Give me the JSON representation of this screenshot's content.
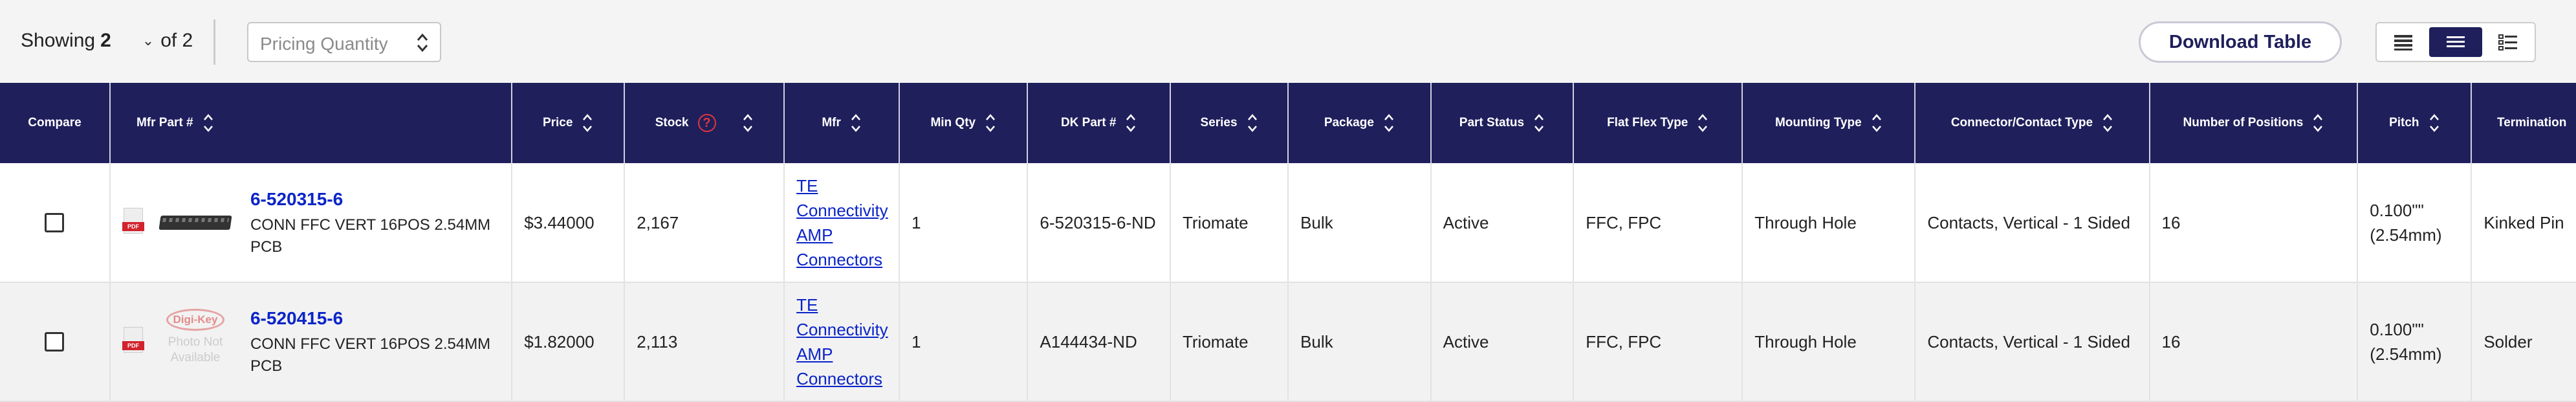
{
  "toolbar": {
    "showing_label": "Showing",
    "showing_value": "2",
    "of_label": "of 2",
    "pricing_placeholder": "Pricing Quantity",
    "download_label": "Download Table"
  },
  "columns": [
    {
      "label": "Compare",
      "sortable": false
    },
    {
      "label": "Mfr Part #",
      "sortable": true
    },
    {
      "label": "Price",
      "sortable": true
    },
    {
      "label": "Stock",
      "sortable": true,
      "help": true
    },
    {
      "label": "Mfr",
      "sortable": true
    },
    {
      "label": "Min Qty",
      "sortable": true
    },
    {
      "label": "DK Part #",
      "sortable": true
    },
    {
      "label": "Series",
      "sortable": true
    },
    {
      "label": "Package",
      "sortable": true
    },
    {
      "label": "Part Status",
      "sortable": true
    },
    {
      "label": "Flat Flex Type",
      "sortable": true
    },
    {
      "label": "Mounting Type",
      "sortable": true
    },
    {
      "label": "Connector/Contact Type",
      "sortable": true
    },
    {
      "label": "Number of Positions",
      "sortable": true
    },
    {
      "label": "Pitch",
      "sortable": true
    },
    {
      "label": "Termination",
      "sortable": true
    }
  ],
  "rows": [
    {
      "part_number": "6-520315-6",
      "description": "CONN FFC VERT 16POS 2.54MM PCB",
      "photo": "connector",
      "price": "$3.44000",
      "stock": "2,167",
      "mfr": "TE Connectivity AMP Connectors",
      "min_qty": "1",
      "dk_part": "6-520315-6-ND",
      "series": "Triomate",
      "package": "Bulk",
      "part_status": "Active",
      "flat_flex_type": "FFC, FPC",
      "mounting_type": "Through Hole",
      "connector_type": "Contacts, Vertical - 1 Sided",
      "positions": "16",
      "pitch": "0.100\"\" (2.54mm)",
      "termination": "Kinked Pin"
    },
    {
      "part_number": "6-520415-6",
      "description": "CONN FFC VERT 16POS 2.54MM PCB",
      "photo": "none",
      "photo_logo": "Digi-Key",
      "photo_text": "Photo Not Available",
      "price": "$1.82000",
      "stock": "2,113",
      "mfr": "TE Connectivity AMP Connectors",
      "min_qty": "1",
      "dk_part": "A144434-ND",
      "series": "Triomate",
      "package": "Bulk",
      "part_status": "Active",
      "flat_flex_type": "FFC, FPC",
      "mounting_type": "Through Hole",
      "connector_type": "Contacts, Vertical - 1 Sided",
      "positions": "16",
      "pitch": "0.100\"\" (2.54mm)",
      "termination": "Solder"
    }
  ],
  "pdf_label": "PDF",
  "colors": {
    "header_bg": "#1f1f5c",
    "link": "#0a24c8",
    "help": "#e0363c"
  }
}
